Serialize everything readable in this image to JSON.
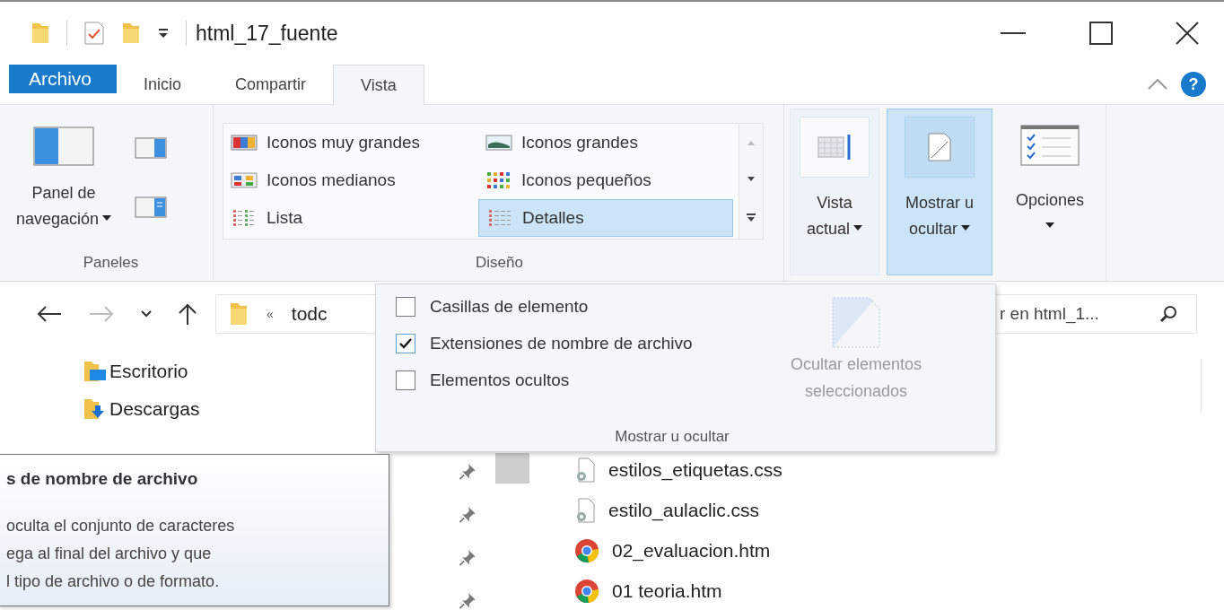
{
  "title_bar": {
    "title": "html_17_fuente"
  },
  "ribbon_tabs": [
    {
      "label": "Archivo",
      "kind": "file",
      "selected": false
    },
    {
      "label": "Inicio",
      "kind": "tab",
      "selected": false
    },
    {
      "label": "Compartir",
      "kind": "tab",
      "selected": false
    },
    {
      "label": "Vista",
      "kind": "tab",
      "selected": true
    }
  ],
  "help": {
    "label": "?"
  },
  "ribbon": {
    "panes": {
      "button_lines": [
        "Panel de",
        "navegación"
      ],
      "label": "Paneles"
    },
    "layout": {
      "label": "Diseño",
      "options": [
        {
          "label": "Iconos muy grandes",
          "kind": "xl",
          "selected": false
        },
        {
          "label": "Iconos grandes",
          "kind": "lg",
          "selected": false
        },
        {
          "label": "Iconos medianos",
          "kind": "md",
          "selected": false
        },
        {
          "label": "Iconos pequeños",
          "kind": "sm",
          "selected": false
        },
        {
          "label": "Lista",
          "kind": "list",
          "selected": false
        },
        {
          "label": "Detalles",
          "kind": "details",
          "selected": true
        }
      ]
    },
    "view_buttons": [
      {
        "lines": [
          "Vista",
          "actual"
        ],
        "kind": "current",
        "selected": false
      },
      {
        "lines": [
          "Mostrar u",
          "ocultar"
        ],
        "kind": "showhide",
        "selected": true
      },
      {
        "lines": [
          "Opciones"
        ],
        "kind": "options",
        "selected": false
      }
    ]
  },
  "address": {
    "separator": "«",
    "path": "todc"
  },
  "search": {
    "placeholder": "r en html_1..."
  },
  "nav_pane": [
    {
      "label": "Escritorio",
      "kind": "desktop"
    },
    {
      "label": "Descargas",
      "kind": "downloads"
    }
  ],
  "files": [
    {
      "name": "estilos_etiquetas.css",
      "kind": "css"
    },
    {
      "name": "estilo_aulaclic.css",
      "kind": "css"
    },
    {
      "name": "02_evaluacion.htm",
      "kind": "web"
    },
    {
      "name": "01 teoria.htm",
      "kind": "web"
    }
  ],
  "show_hide_menu": {
    "options": [
      {
        "label": "Casillas de elemento",
        "checked": false
      },
      {
        "label": "Extensiones de nombre de archivo",
        "checked": true
      },
      {
        "label": "Elementos ocultos",
        "checked": false
      }
    ],
    "hide_selected": {
      "lines": [
        "Ocultar elementos",
        "seleccionados"
      ],
      "disabled": true
    },
    "footer": "Mostrar u ocultar"
  },
  "tooltip": {
    "title": "s de nombre de archivo",
    "body": "oculta el conjunto de caracteres\nega al final del archivo y que\nl tipo de archivo o de formato."
  }
}
